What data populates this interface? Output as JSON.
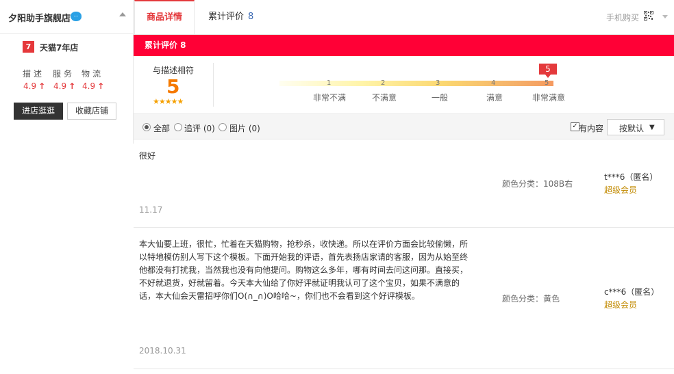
{
  "shop": {
    "name": "夕阳助手旗舰店",
    "tmall_badge": "7",
    "tmall_years": "天猫7年店",
    "scores": [
      {
        "label": "描述",
        "value": "4.9"
      },
      {
        "label": "服务",
        "value": "4.9"
      },
      {
        "label": "物流",
        "value": "4.9"
      }
    ],
    "enter_label": "进店逛逛",
    "favorite_label": "收藏店铺"
  },
  "tabs": {
    "detail": "商品详情",
    "reviews": "累计评价",
    "reviews_count": "8",
    "mobile_buy": "手机购买"
  },
  "review_bar": {
    "title": "累计评价 8"
  },
  "rating": {
    "match_label": "与描述相符",
    "match_score": "5",
    "stars": "★★★★★",
    "marker": "5",
    "scale": [
      {
        "num": "1",
        "label": "非常不满"
      },
      {
        "num": "2",
        "label": "不满意"
      },
      {
        "num": "3",
        "label": "一般"
      },
      {
        "num": "4",
        "label": "满意"
      },
      {
        "num": "5",
        "label": "非常满意"
      }
    ]
  },
  "filters": {
    "all": "全部",
    "followup": "追评 (0)",
    "images": "图片 (0)",
    "has_content": "有内容",
    "sort": "按默认",
    "selected": "all"
  },
  "reviews": [
    {
      "text": "很好",
      "sku": "颜色分类：108B右",
      "user": "t***6（匿名）",
      "member": "超级会员",
      "date": "11.17"
    },
    {
      "text": "本大仙要上班，很忙，忙着在天猫购物，抢秒杀，收快递。所以在评价方面会比较偷懒，所以特地模仿别人写下这个模板。下面开始我的评语，首先表扬店家请的客服，因为从始至终他都没有打扰我，当然我也没有向他提问。购物这么多年，哪有时间去问这问那。直接买，不好就退货，好就留着。今天本大仙给了你好评就证明我认可了这个宝贝，如果不满意的话，本大仙会天雷招呼你们O(∩_∩)O哈哈~，你们也不会看到这个好评模板。",
      "sku": "颜色分类：黄色",
      "user": "c***6（匿名）",
      "member": "超级会员",
      "date": "2018.10.31"
    }
  ],
  "colors": {
    "accent": "#ff0036",
    "tab_active": "#e4393c",
    "score": "#f57a00",
    "member": "#c28a00"
  }
}
